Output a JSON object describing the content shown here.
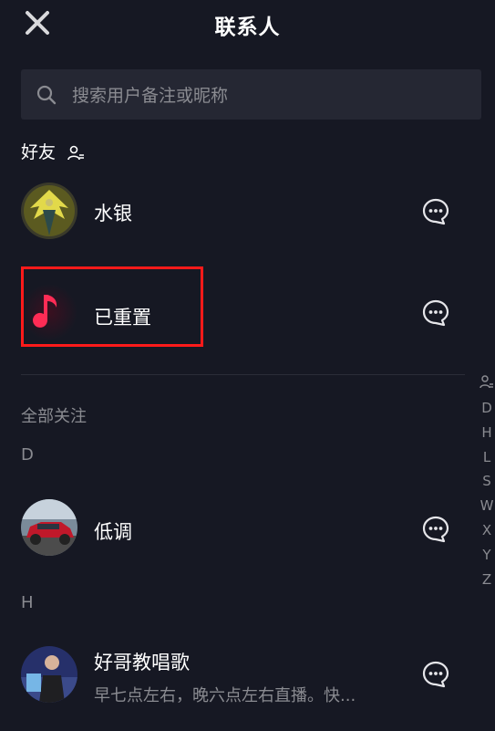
{
  "header": {
    "title": "联系人"
  },
  "search": {
    "placeholder": "搜索用户备注或昵称"
  },
  "friends_section": {
    "label": "好友"
  },
  "friends": [
    {
      "name": "水银"
    },
    {
      "name": "已重置"
    }
  ],
  "all_following": {
    "label": "全部关注"
  },
  "groups": [
    {
      "letter": "D",
      "items": [
        {
          "name": "低调"
        }
      ]
    },
    {
      "letter": "H",
      "items": [
        {
          "name": "好哥教唱歌",
          "subtitle": "早七点左右，晚六点左右直播。快..."
        }
      ]
    }
  ],
  "index_letters": [
    "D",
    "H",
    "L",
    "S",
    "W",
    "X",
    "Y",
    "Z"
  ],
  "colors": {
    "background": "#161823",
    "highlight_border": "#ff1a1a",
    "muted_text": "#8a8b91",
    "search_bg": "#252733"
  }
}
